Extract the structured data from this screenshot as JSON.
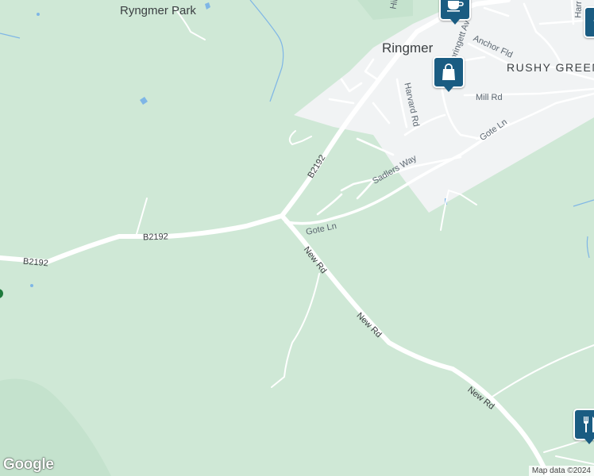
{
  "colors": {
    "park": "#cfe8d6",
    "urban": "#f1f3f4",
    "road": "#ffffff",
    "water": "#7fb6e6",
    "poi": "#1a5c82"
  },
  "places": {
    "ryngmer_park": "Ryngmer Park",
    "ringmer": "Ringmer",
    "rushy_green": "RUSHY GREEN"
  },
  "roads": {
    "b2192_a": "B2192",
    "b2192_b": "B2192",
    "b2192_c": "B2192",
    "gote_ln_a": "Gote Ln",
    "gote_ln_b": "Gote Ln",
    "new_rd_a": "New Rd",
    "new_rd_b": "New Rd",
    "new_rd_c": "New Rd",
    "harvard_rd": "Harvard Rd",
    "sadlers_way": "Sadlers Way",
    "mill_rd": "Mill Rd",
    "anchor_fld": "Anchor Fld",
    "springett_av": "Springett Av",
    "hill": "Hill",
    "harr": "Harr"
  },
  "pois": {
    "cafe": "cafe-icon",
    "shopping": "shopping-bag-icon",
    "restaurant": "restaurant-icon",
    "school": "school-icon"
  },
  "footer": {
    "logo": "Google",
    "attribution": "Map data ©2024"
  }
}
